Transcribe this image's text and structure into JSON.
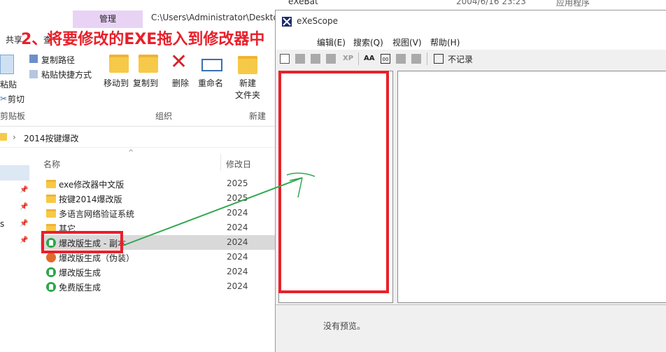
{
  "explorer": {
    "manage_tab": "管理",
    "path_title": "C:\\Users\\Administrator\\Desktop",
    "ribbon_tabs": [
      "共享",
      "查"
    ],
    "ribbon": {
      "copy_path": "复制路径",
      "paste_shortcut": "粘贴快捷方式",
      "paste": "粘贴",
      "cut": "剪切",
      "clipboard": "剪贴板",
      "move_to": "移动到",
      "copy_to": "复制到",
      "delete": "删除",
      "rename": "重命名",
      "organize": "组织",
      "new_folder_l1": "新建",
      "new_folder_l2": "文件夹",
      "new_group": "新建"
    },
    "address": "2014按键爆改",
    "columns": {
      "name": "名称",
      "modified": "修改日"
    },
    "nav_partial": "s",
    "files": [
      {
        "name": "exe修改器中文版",
        "date": "2025",
        "icon": "folder-icon"
      },
      {
        "name": "按键2014爆改版",
        "date": "2025",
        "icon": "folder-icon"
      },
      {
        "name": "多语言网络验证系统",
        "date": "2024",
        "icon": "folder-icon"
      },
      {
        "name": "其它",
        "date": "2024",
        "icon": "folder-icon"
      },
      {
        "name": "爆改版生成 - 副本",
        "date": "2024",
        "icon": "app-icon"
      },
      {
        "name": "爆改版生成（伪装）",
        "date": "2024",
        "icon": "fake-app-icon"
      },
      {
        "name": "爆改版生成",
        "date": "2024",
        "icon": "app-icon"
      },
      {
        "name": "免费版生成",
        "date": "2024",
        "icon": "app-icon"
      }
    ],
    "no_preview": "没有预览。"
  },
  "behind": {
    "name": "eXeBat",
    "date": "2004/6/16 23:23",
    "type": "应用程序"
  },
  "exescope": {
    "title": "eXeScope",
    "menu": [
      "编辑(E)",
      "搜索(Q)",
      "视图(V)",
      "帮助(H)"
    ],
    "toolbar_record": "不记录"
  },
  "annotation": {
    "text": "2、将要修改的EXE拖入到修改器中",
    "color": "#e8202a"
  }
}
